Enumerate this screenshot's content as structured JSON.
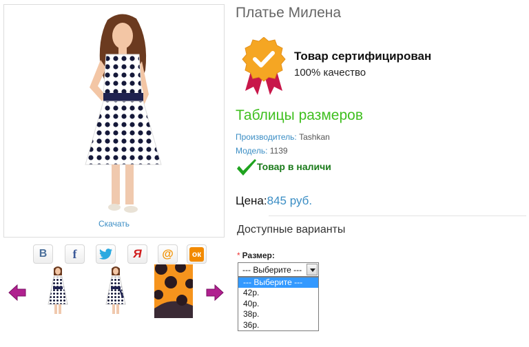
{
  "product": {
    "title": "Платье Милена",
    "download_label": "Скачать"
  },
  "certificate": {
    "title": "Товар сертифицирован",
    "subtitle": "100% качество"
  },
  "size_tables_link": "Таблицы размеров",
  "manufacturer": {
    "label": "Производитель:",
    "value": "Tashkan"
  },
  "model": {
    "label": "Модель:",
    "value": "1139"
  },
  "availability": "Товар в наличи",
  "price": {
    "label": "Цена:",
    "value": "845 руб."
  },
  "variants": {
    "heading": "Доступные варианты",
    "size_label": "Размер:",
    "required_mark": "*",
    "selected": "--- Выберите ---",
    "options": [
      "--- Выберите ---",
      "42р.",
      "40р.",
      "38р.",
      "36р."
    ]
  },
  "social": [
    {
      "icon": "vkontakte-icon",
      "glyph": "В",
      "color": "#4a6e9a"
    },
    {
      "icon": "facebook-icon",
      "glyph": "f",
      "color": "#3b5998"
    },
    {
      "icon": "twitter-icon",
      "glyph": "🐦",
      "color": "#2aa9e0"
    },
    {
      "icon": "yaru-icon",
      "glyph": "Я",
      "color": "#d01c1c"
    },
    {
      "icon": "mailru-icon",
      "glyph": "@",
      "color": "#f39200"
    },
    {
      "icon": "odnoklassniki-icon",
      "glyph": "ок",
      "color": "#f28a00"
    }
  ],
  "colors": {
    "accent_blue": "#3a8dc4",
    "green": "#3fbf1f",
    "arrow": "#b0208f"
  }
}
